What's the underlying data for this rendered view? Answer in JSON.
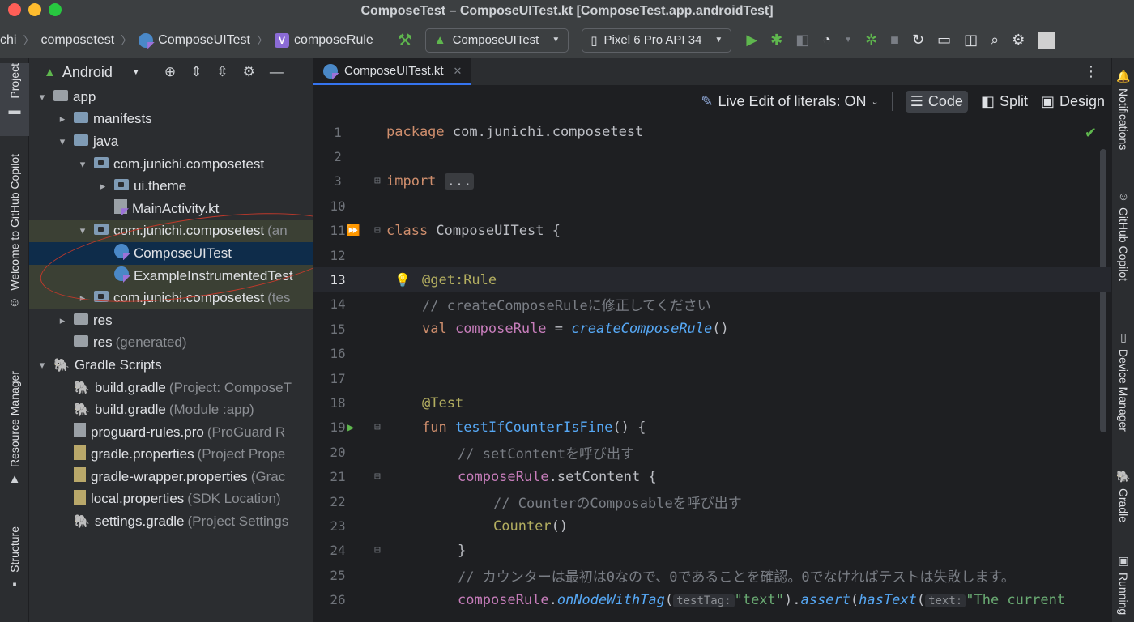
{
  "window": {
    "title": "ComposeTest – ComposeUITest.kt [ComposeTest.app.androidTest]"
  },
  "breadcrumbs": [
    "chi",
    "composetest",
    "ComposeUITest",
    "composeRule"
  ],
  "toolbar": {
    "run_config": "ComposeUITest",
    "device": "Pixel 6 Pro API 34"
  },
  "left_strip": [
    "Project",
    "Welcome to GitHub Copilot",
    "Resource Manager",
    "Structure"
  ],
  "project_panel": {
    "view_mode": "Android",
    "tree": [
      {
        "label": "app",
        "muted": "",
        "level": 0,
        "arrow": "▾",
        "icon": "module"
      },
      {
        "label": "manifests",
        "muted": "",
        "level": 1,
        "arrow": "▸",
        "icon": "folder"
      },
      {
        "label": "java",
        "muted": "",
        "level": 1,
        "arrow": "▾",
        "icon": "folder"
      },
      {
        "label": "com.junichi.composetest",
        "muted": "",
        "level": 2,
        "arrow": "▾",
        "icon": "package"
      },
      {
        "label": "ui.theme",
        "muted": "",
        "level": 3,
        "arrow": "▸",
        "icon": "package"
      },
      {
        "label": "MainActivity.kt",
        "muted": "",
        "level": 3,
        "arrow": "",
        "icon": "kotlin"
      },
      {
        "label": "com.junichi.composetest",
        "muted": "(an",
        "level": 2,
        "arrow": "▾",
        "icon": "package"
      },
      {
        "label": "ComposeUITest",
        "muted": "",
        "level": 3,
        "arrow": "",
        "icon": "class"
      },
      {
        "label": "ExampleInstrumentedTest",
        "muted": "",
        "level": 3,
        "arrow": "",
        "icon": "class"
      },
      {
        "label": "com.junichi.composetest",
        "muted": "(tes",
        "level": 2,
        "arrow": "▸",
        "icon": "package"
      },
      {
        "label": "res",
        "muted": "",
        "level": 1,
        "arrow": "▸",
        "icon": "res"
      },
      {
        "label": "res",
        "muted": "(generated)",
        "level": 1,
        "arrow": "",
        "icon": "res"
      },
      {
        "label": "Gradle Scripts",
        "muted": "",
        "level": 0,
        "arrow": "▾",
        "icon": "gradle"
      },
      {
        "label": "build.gradle",
        "muted": "(Project: ComposeT",
        "level": 1,
        "arrow": "",
        "icon": "gradle"
      },
      {
        "label": "build.gradle",
        "muted": "(Module :app)",
        "level": 1,
        "arrow": "",
        "icon": "gradle"
      },
      {
        "label": "proguard-rules.pro",
        "muted": "(ProGuard R",
        "level": 1,
        "arrow": "",
        "icon": "file"
      },
      {
        "label": "gradle.properties",
        "muted": "(Project Prope",
        "level": 1,
        "arrow": "",
        "icon": "props"
      },
      {
        "label": "gradle-wrapper.properties",
        "muted": "(Grac",
        "level": 1,
        "arrow": "",
        "icon": "props"
      },
      {
        "label": "local.properties",
        "muted": "(SDK Location)",
        "level": 1,
        "arrow": "",
        "icon": "props"
      },
      {
        "label": "settings.gradle",
        "muted": "(Project Settings",
        "level": 1,
        "arrow": "",
        "icon": "gradle"
      }
    ]
  },
  "editor": {
    "tab": "ComposeUITest.kt",
    "live_edit": "Live Edit of literals: ON",
    "modes": {
      "code": "Code",
      "split": "Split",
      "design": "Design"
    },
    "lines": {
      "n1": "1",
      "n2": "2",
      "n3": "3",
      "n10": "10",
      "n11": "11",
      "n12": "12",
      "n13": "13",
      "n14": "14",
      "n15": "15",
      "n16": "16",
      "n17": "17",
      "n18": "18",
      "n19": "19",
      "n20": "20",
      "n21": "21",
      "n22": "22",
      "n23": "23",
      "n24": "24",
      "n25": "25",
      "n26": "26"
    },
    "code": {
      "package_kw": "package",
      "package_name": " com.junichi.composetest",
      "import_kw": "import",
      "import_dots": "...",
      "class_kw": "class",
      "class_name": " ComposeUITest {",
      "ann_get": "@get:",
      "ann_rule": "Rule",
      "comment14": "// createComposeRuleに修正してください",
      "val_kw": "val",
      "prop": " composeRule",
      "eq": " = ",
      "create_fn": "createComposeRule",
      "parens": "()",
      "ann_test": "@Test",
      "fun_kw": "fun",
      "fun_name": " testIfCounterIsFine",
      "fun_tail": "() {",
      "comment20": "// setContentを呼び出す",
      "prop21": "composeRule",
      "call21": ".setContent {",
      "comment22": "// CounterのComposableを呼び出す",
      "counter": "Counter",
      "counter_tail": "()",
      "brace24": "}",
      "comment25": "// カウンターは最初は0なので、0であることを確認。0でなければテストは失敗します。",
      "prop26": "composeRule",
      "dot26": ".",
      "on_node": "onNodeWithTag",
      "open26": "(",
      "hint_tag": "testTag:",
      "str_text": "\"text\"",
      "close26": ").",
      "assert": "assert",
      "open26b": "(",
      "has_text": "hasText",
      "open26c": "(",
      "hint_text": "text:",
      "str_current": "\"The current"
    }
  },
  "right_strip": [
    "Notifications",
    "GitHub Copilot",
    "Device Manager",
    "Gradle",
    "Running"
  ],
  "colors": {
    "accent": "#3574f0",
    "run_green": "#5fb74e",
    "annotation_red": "#c0392b"
  }
}
